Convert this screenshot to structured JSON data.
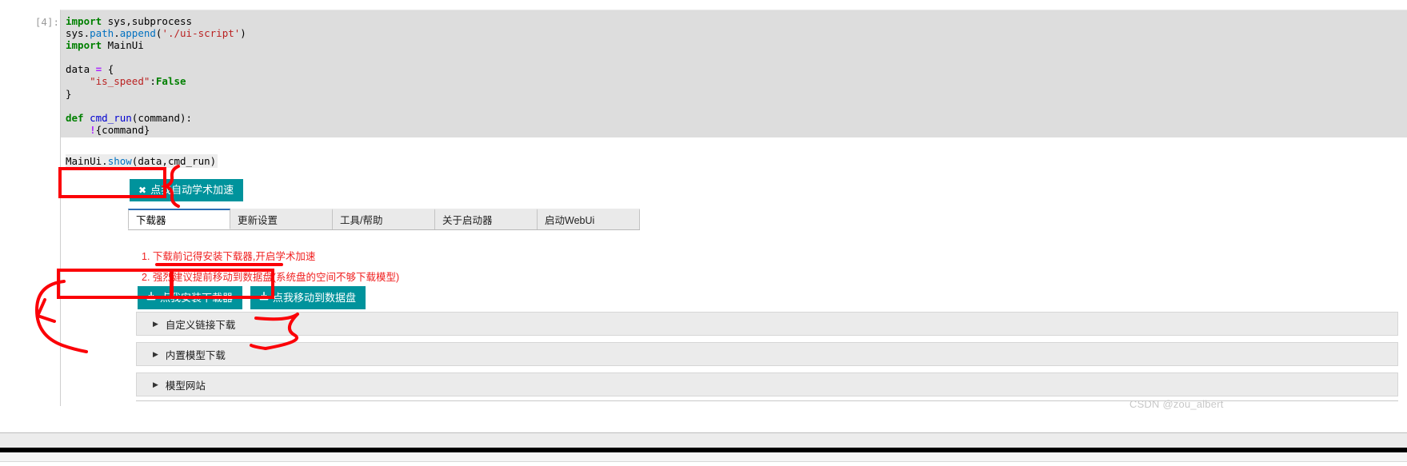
{
  "notebook": {
    "prompt": "[4]:",
    "code_lines": [
      [
        {
          "t": "import",
          "c": "kw"
        },
        {
          "t": " sys,subprocess",
          "c": "plain"
        }
      ],
      [
        {
          "t": "sys.",
          "c": "plain"
        },
        {
          "t": "path",
          "c": "attr"
        },
        {
          "t": ".",
          "c": "plain"
        },
        {
          "t": "append",
          "c": "attr"
        },
        {
          "t": "(",
          "c": "plain"
        },
        {
          "t": "'./ui-script'",
          "c": "str"
        },
        {
          "t": ")",
          "c": "plain"
        }
      ],
      [
        {
          "t": "import",
          "c": "kw"
        },
        {
          "t": " MainUi",
          "c": "plain"
        }
      ],
      [
        {
          "t": "",
          "c": "plain"
        }
      ],
      [
        {
          "t": "data ",
          "c": "plain"
        },
        {
          "t": "=",
          "c": "op"
        },
        {
          "t": " {",
          "c": "plain"
        }
      ],
      [
        {
          "t": "    ",
          "c": "plain"
        },
        {
          "t": "\"is_speed\"",
          "c": "str"
        },
        {
          "t": ":",
          "c": "plain"
        },
        {
          "t": "False",
          "c": "bool"
        }
      ],
      [
        {
          "t": "}",
          "c": "plain"
        }
      ],
      [
        {
          "t": "",
          "c": "plain"
        }
      ],
      [
        {
          "t": "def",
          "c": "kw"
        },
        {
          "t": " ",
          "c": "plain"
        },
        {
          "t": "cmd_run",
          "c": "fn"
        },
        {
          "t": "(command):",
          "c": "plain"
        }
      ],
      [
        {
          "t": "    ",
          "c": "plain"
        },
        {
          "t": "!",
          "c": "bang"
        },
        {
          "t": "{command}",
          "c": "plain"
        }
      ]
    ],
    "output_line": [
      {
        "t": "MainUi.",
        "c": "plain"
      },
      {
        "t": "show",
        "c": "attr"
      },
      {
        "t": "(data,cmd_run)",
        "c": "plain"
      }
    ]
  },
  "app": {
    "accel_button": {
      "icon": "close-x-icon",
      "icon_glyph": "✖",
      "label": "点我自动学术加速"
    },
    "tabs": [
      {
        "label": "下载器",
        "active": true
      },
      {
        "label": "更新设置",
        "active": false
      },
      {
        "label": "工具/帮助",
        "active": false
      },
      {
        "label": "关于启动器",
        "active": false
      },
      {
        "label": "启动WebUi",
        "active": false
      }
    ],
    "notices": [
      "1. 下载前记得安装下载器,开启学术加速",
      "2. 强烈建议提前移动到数据盘(系统盘的空间不够下载模型)"
    ],
    "download_buttons": [
      {
        "icon": "download-icon",
        "icon_glyph": "⭳",
        "label": "点我安装下载器"
      },
      {
        "icon": "download-icon",
        "icon_glyph": "⭳",
        "label": "点我移动到数据盘"
      }
    ],
    "accordions": [
      {
        "caret": "▶",
        "label": "自定义链接下载"
      },
      {
        "caret": "▶",
        "label": "内置模型下载"
      },
      {
        "caret": "▶",
        "label": "模型网站"
      }
    ],
    "colors": {
      "teal": "#00939c",
      "notice_red": "#f02020",
      "active_tab_underline": "#2f6fb5",
      "annotation_red": "#fb0007"
    }
  },
  "watermark": "CSDN @zou_albert"
}
